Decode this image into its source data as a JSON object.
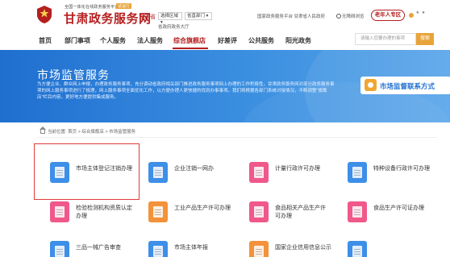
{
  "header": {
    "tagline": "全国一体化在线政务服务平台",
    "beta_badge": "试运行",
    "site_name": "甘肃政务服务网",
    "region": "甘肃省",
    "region_select": "选择区域 ▾",
    "department_select": "省直部门 ▾",
    "subregion": "省政府政务大厅",
    "top_links": "国家政务服务平台  甘肃省人民政府",
    "accessibility": "无障碍浏览",
    "elder_button": "老年人专区",
    "more_dots": "● ●"
  },
  "nav": {
    "items": [
      "首页",
      "部门事项",
      "个人服务",
      "法人服务",
      "综合旗舰店",
      "好差评",
      "公共服务",
      "阳光政务"
    ],
    "active": "综合旗舰店",
    "search_placeholder": "请输入您要办理的事项",
    "search_button": "搜索"
  },
  "banner": {
    "title": "市场监管服务",
    "description": "为方便企业、群众网上申报，办理政务服务事项，充分调动省政府相关部门推进政务服务事项网上办理的工作积极性，甘肃政务服务网对部分政务服务事项的网上服务事项进行了梳理，网上服务事项全面优化工作，以方便办理人更快捷的找到办事事项。我们将根据各部门系统对接情况，不断调整\"旗舰店\"栏目内容，更好地方便提供集成服务。",
    "contact_button": "市场监督联系方式"
  },
  "breadcrumb": {
    "prefix": "当前位置:",
    "path": "首页 > 综合旗舰店 > 市场监管服务"
  },
  "services": [
    {
      "label": "市场主体登记注销办理",
      "color": "#3d8fe8"
    },
    {
      "label": "企业注销一网办",
      "color": "#3d8fe8"
    },
    {
      "label": "计量行政许可办理",
      "color": "#f0588a"
    },
    {
      "label": "特种设备行政许可办理",
      "color": "#3d8fe8"
    },
    {
      "label": "检验检测机构资质认定办理",
      "color": "#f0588a"
    },
    {
      "label": "工业产品生产许可办理",
      "color": "#f3923a"
    },
    {
      "label": "食品相关产品生产许可办理",
      "color": "#f0588a"
    },
    {
      "label": "食品生产许可证办理",
      "color": "#f0588a"
    },
    {
      "label": "三品一械广告审查",
      "color": "#3d8fe8"
    },
    {
      "label": "市场主体年报",
      "color": "#3d8fe8"
    },
    {
      "label": "国家企业信用信息公示",
      "color": "#f3923a"
    },
    {
      "label": "",
      "color": "#3d8fe8"
    }
  ]
}
